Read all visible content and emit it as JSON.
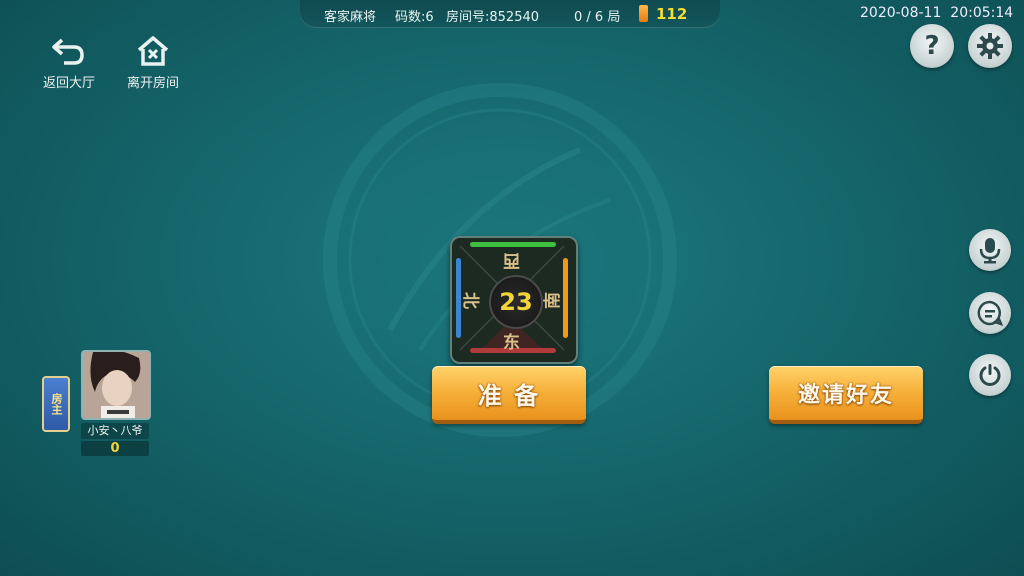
{
  "top_bar": {
    "game_name": "客家麻将",
    "code_count": "码数:6",
    "room_number": "房间号:852540",
    "round_progress": "0 / 6 局",
    "coins": "112"
  },
  "datetime": {
    "date": "2020-08-11",
    "time": "20:05:14"
  },
  "nav": {
    "back_label": "返回大厅",
    "leave_label": "离开房间"
  },
  "right_buttons": {
    "help": "?",
    "settings_icon": "gear-icon",
    "mic_icon": "microphone-icon",
    "chat_icon": "chat-icon",
    "power_icon": "power-icon"
  },
  "compass": {
    "top": "西",
    "left": "北",
    "right": "南",
    "bottom": "东",
    "count": "23"
  },
  "buttons": {
    "ready": "准 备",
    "invite": "邀请好友"
  },
  "player": {
    "owner_tag": "房主",
    "name": "小安丶八爷",
    "score": "0"
  },
  "colors": {
    "background": "#15676c",
    "accent_orange": "#f7b23d",
    "coin_text": "#f7dc32",
    "compass_green": "#3fbf3f",
    "compass_blue": "#3a86d6",
    "compass_orange": "#f09a1a",
    "compass_red": "#b13a3a"
  }
}
